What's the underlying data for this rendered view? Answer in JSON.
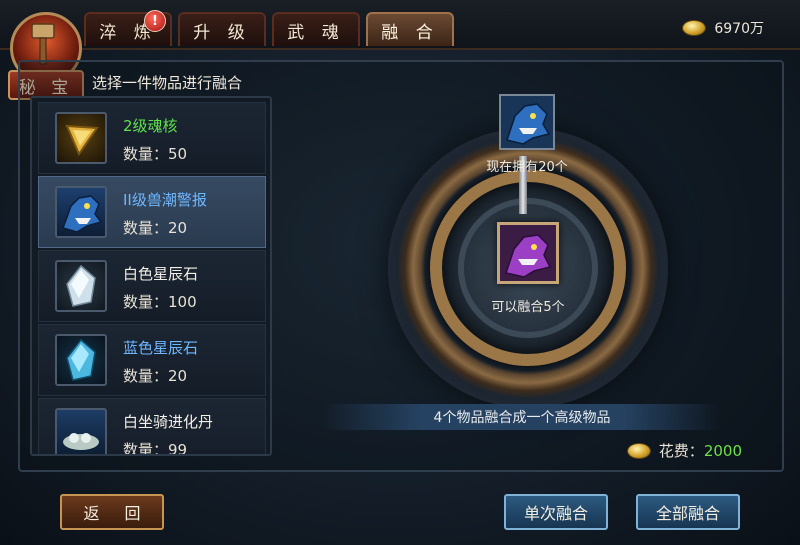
{
  "emblem": {
    "label": "秘 宝"
  },
  "tabs": [
    {
      "label": "淬 炼",
      "active": false,
      "badge": "!"
    },
    {
      "label": "升 级",
      "active": false
    },
    {
      "label": "武 魂",
      "active": false
    },
    {
      "label": "融 合",
      "active": true
    }
  ],
  "currency": {
    "amount": "6970万",
    "icon": "gold-coin-icon"
  },
  "list": {
    "title": "选择一件物品进行融合",
    "items": [
      {
        "name": "2级魂核",
        "qty": "数量：50",
        "name_color": "#5fe04a",
        "icon": "soul-core-icon"
      },
      {
        "name": "II级兽潮警报",
        "qty": "数量：20",
        "name_color": "#6fb7ff",
        "icon": "beast-tide-alarm-icon",
        "selected": true
      },
      {
        "name": "白色星辰石",
        "qty": "数量：100",
        "name_color": "#f2efe6",
        "icon": "white-star-stone-icon"
      },
      {
        "name": "蓝色星辰石",
        "qty": "数量：20",
        "name_color": "#6fb7ff",
        "icon": "blue-star-stone-icon"
      },
      {
        "name": "白坐骑进化丹",
        "qty": "数量：99",
        "name_color": "#f2efe6",
        "icon": "mount-evolution-pill-icon"
      }
    ]
  },
  "fusion": {
    "source_label": "现在拥有20个",
    "result_label": "可以融合5个",
    "info": "4个物品融合成一个高级物品",
    "cost_label": "花费：",
    "cost_value": "2000"
  },
  "buttons": {
    "back": "返 回",
    "single": "单次融合",
    "all": "全部融合"
  }
}
